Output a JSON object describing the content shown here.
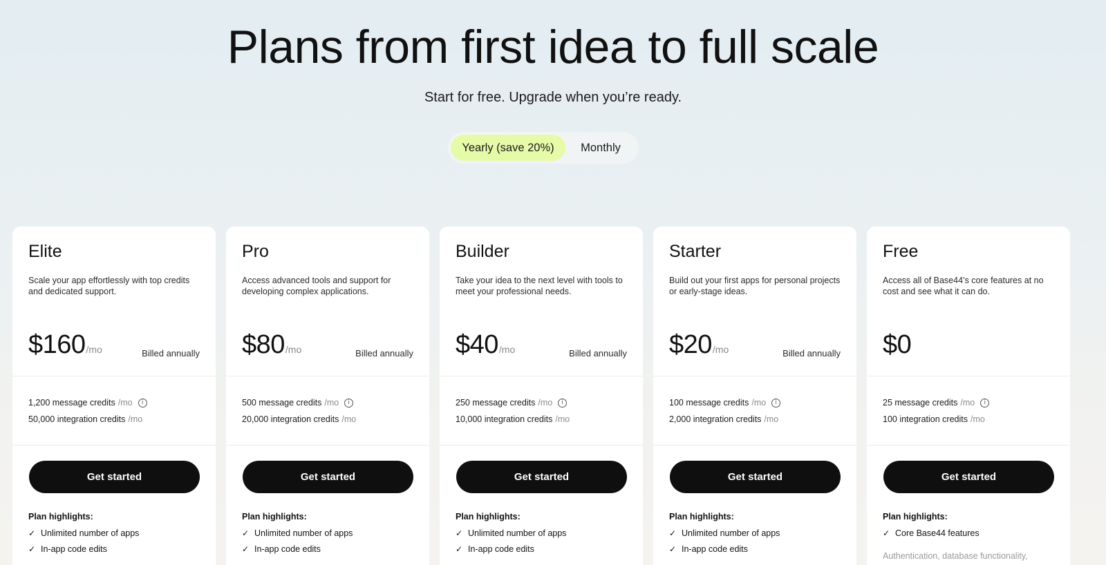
{
  "hero": {
    "title": "Plans from first idea to full scale",
    "subtitle": "Start for free. Upgrade when you’re ready."
  },
  "billing_toggle": {
    "yearly_label": "Yearly (save 20%)",
    "monthly_label": "Monthly",
    "selected": "yearly"
  },
  "colors": {
    "accent_toggle": "#e6fba8",
    "cta_bg": "#0f0f0f",
    "card_bg": "#ffffff"
  },
  "plans": [
    {
      "name": "Elite",
      "description": "Scale your app effortlessly with top credits and dedicated support.",
      "price": "$160",
      "per": "/mo",
      "billed": "Billed annually",
      "message_credits": "1,200 message credits",
      "integration_credits": "50,000 integration credits",
      "credit_unit": "/mo",
      "cta": "Get started",
      "highlights_title": "Plan highlights:",
      "highlights": [
        "Unlimited number of apps",
        "In-app code edits"
      ]
    },
    {
      "name": "Pro",
      "description": "Access advanced tools and support for developing complex applications.",
      "price": "$80",
      "per": "/mo",
      "billed": "Billed annually",
      "message_credits": "500 message credits",
      "integration_credits": "20,000 integration credits",
      "credit_unit": "/mo",
      "cta": "Get started",
      "highlights_title": "Plan highlights:",
      "highlights": [
        "Unlimited number of apps",
        "In-app code edits"
      ]
    },
    {
      "name": "Builder",
      "description": "Take your idea to the next level with tools to meet your professional needs.",
      "price": "$40",
      "per": "/mo",
      "billed": "Billed annually",
      "message_credits": "250 message credits",
      "integration_credits": "10,000 integration credits",
      "credit_unit": "/mo",
      "cta": "Get started",
      "highlights_title": "Plan highlights:",
      "highlights": [
        "Unlimited number of apps",
        "In-app code edits"
      ]
    },
    {
      "name": "Starter",
      "description": "Build out your first apps for personal projects or early-stage ideas.",
      "price": "$20",
      "per": "/mo",
      "billed": "Billed annually",
      "message_credits": "100 message credits",
      "integration_credits": "2,000 integration credits",
      "credit_unit": "/mo",
      "cta": "Get started",
      "highlights_title": "Plan highlights:",
      "highlights": [
        "Unlimited number of apps",
        "In-app code edits"
      ]
    },
    {
      "name": "Free",
      "description": "Access all of Base44’s core features at no cost and see what it can do.",
      "price": "$0",
      "per": "",
      "billed": "",
      "message_credits": "25 message credits",
      "integration_credits": "100 integration credits",
      "credit_unit": "/mo",
      "cta": "Get started",
      "highlights_title": "Plan highlights:",
      "highlights": [
        "Core Base44 features"
      ],
      "highlights_note": "Authentication, database functionality,"
    }
  ]
}
